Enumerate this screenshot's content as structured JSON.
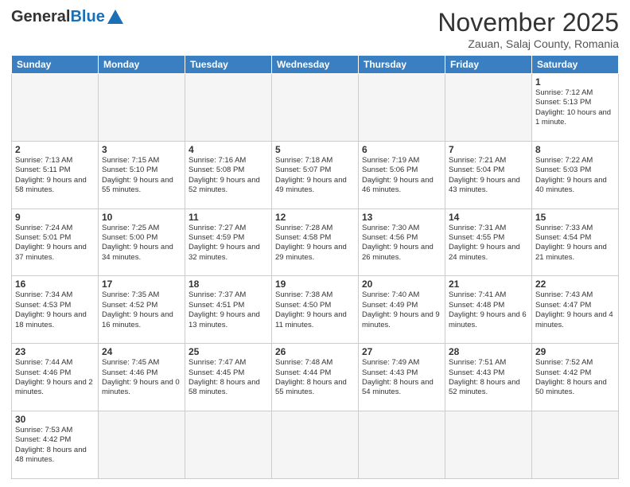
{
  "logo": {
    "general": "General",
    "blue": "Blue"
  },
  "title": "November 2025",
  "subtitle": "Zauan, Salaj County, Romania",
  "weekdays": [
    "Sunday",
    "Monday",
    "Tuesday",
    "Wednesday",
    "Thursday",
    "Friday",
    "Saturday"
  ],
  "weeks": [
    [
      {
        "day": "",
        "info": "",
        "empty": true
      },
      {
        "day": "",
        "info": "",
        "empty": true
      },
      {
        "day": "",
        "info": "",
        "empty": true
      },
      {
        "day": "",
        "info": "",
        "empty": true
      },
      {
        "day": "",
        "info": "",
        "empty": true
      },
      {
        "day": "",
        "info": "",
        "empty": true
      },
      {
        "day": "1",
        "info": "Sunrise: 7:12 AM\nSunset: 5:13 PM\nDaylight: 10 hours and 1 minute."
      }
    ],
    [
      {
        "day": "2",
        "info": "Sunrise: 7:13 AM\nSunset: 5:11 PM\nDaylight: 9 hours and 58 minutes."
      },
      {
        "day": "3",
        "info": "Sunrise: 7:15 AM\nSunset: 5:10 PM\nDaylight: 9 hours and 55 minutes."
      },
      {
        "day": "4",
        "info": "Sunrise: 7:16 AM\nSunset: 5:08 PM\nDaylight: 9 hours and 52 minutes."
      },
      {
        "day": "5",
        "info": "Sunrise: 7:18 AM\nSunset: 5:07 PM\nDaylight: 9 hours and 49 minutes."
      },
      {
        "day": "6",
        "info": "Sunrise: 7:19 AM\nSunset: 5:06 PM\nDaylight: 9 hours and 46 minutes."
      },
      {
        "day": "7",
        "info": "Sunrise: 7:21 AM\nSunset: 5:04 PM\nDaylight: 9 hours and 43 minutes."
      },
      {
        "day": "8",
        "info": "Sunrise: 7:22 AM\nSunset: 5:03 PM\nDaylight: 9 hours and 40 minutes."
      }
    ],
    [
      {
        "day": "9",
        "info": "Sunrise: 7:24 AM\nSunset: 5:01 PM\nDaylight: 9 hours and 37 minutes."
      },
      {
        "day": "10",
        "info": "Sunrise: 7:25 AM\nSunset: 5:00 PM\nDaylight: 9 hours and 34 minutes."
      },
      {
        "day": "11",
        "info": "Sunrise: 7:27 AM\nSunset: 4:59 PM\nDaylight: 9 hours and 32 minutes."
      },
      {
        "day": "12",
        "info": "Sunrise: 7:28 AM\nSunset: 4:58 PM\nDaylight: 9 hours and 29 minutes."
      },
      {
        "day": "13",
        "info": "Sunrise: 7:30 AM\nSunset: 4:56 PM\nDaylight: 9 hours and 26 minutes."
      },
      {
        "day": "14",
        "info": "Sunrise: 7:31 AM\nSunset: 4:55 PM\nDaylight: 9 hours and 24 minutes."
      },
      {
        "day": "15",
        "info": "Sunrise: 7:33 AM\nSunset: 4:54 PM\nDaylight: 9 hours and 21 minutes."
      }
    ],
    [
      {
        "day": "16",
        "info": "Sunrise: 7:34 AM\nSunset: 4:53 PM\nDaylight: 9 hours and 18 minutes."
      },
      {
        "day": "17",
        "info": "Sunrise: 7:35 AM\nSunset: 4:52 PM\nDaylight: 9 hours and 16 minutes."
      },
      {
        "day": "18",
        "info": "Sunrise: 7:37 AM\nSunset: 4:51 PM\nDaylight: 9 hours and 13 minutes."
      },
      {
        "day": "19",
        "info": "Sunrise: 7:38 AM\nSunset: 4:50 PM\nDaylight: 9 hours and 11 minutes."
      },
      {
        "day": "20",
        "info": "Sunrise: 7:40 AM\nSunset: 4:49 PM\nDaylight: 9 hours and 9 minutes."
      },
      {
        "day": "21",
        "info": "Sunrise: 7:41 AM\nSunset: 4:48 PM\nDaylight: 9 hours and 6 minutes."
      },
      {
        "day": "22",
        "info": "Sunrise: 7:43 AM\nSunset: 4:47 PM\nDaylight: 9 hours and 4 minutes."
      }
    ],
    [
      {
        "day": "23",
        "info": "Sunrise: 7:44 AM\nSunset: 4:46 PM\nDaylight: 9 hours and 2 minutes."
      },
      {
        "day": "24",
        "info": "Sunrise: 7:45 AM\nSunset: 4:46 PM\nDaylight: 9 hours and 0 minutes."
      },
      {
        "day": "25",
        "info": "Sunrise: 7:47 AM\nSunset: 4:45 PM\nDaylight: 8 hours and 58 minutes."
      },
      {
        "day": "26",
        "info": "Sunrise: 7:48 AM\nSunset: 4:44 PM\nDaylight: 8 hours and 55 minutes."
      },
      {
        "day": "27",
        "info": "Sunrise: 7:49 AM\nSunset: 4:43 PM\nDaylight: 8 hours and 54 minutes."
      },
      {
        "day": "28",
        "info": "Sunrise: 7:51 AM\nSunset: 4:43 PM\nDaylight: 8 hours and 52 minutes."
      },
      {
        "day": "29",
        "info": "Sunrise: 7:52 AM\nSunset: 4:42 PM\nDaylight: 8 hours and 50 minutes."
      }
    ],
    [
      {
        "day": "30",
        "info": "Sunrise: 7:53 AM\nSunset: 4:42 PM\nDaylight: 8 hours and 48 minutes."
      },
      {
        "day": "",
        "info": "",
        "empty": true
      },
      {
        "day": "",
        "info": "",
        "empty": true
      },
      {
        "day": "",
        "info": "",
        "empty": true
      },
      {
        "day": "",
        "info": "",
        "empty": true
      },
      {
        "day": "",
        "info": "",
        "empty": true
      },
      {
        "day": "",
        "info": "",
        "empty": true
      }
    ]
  ]
}
